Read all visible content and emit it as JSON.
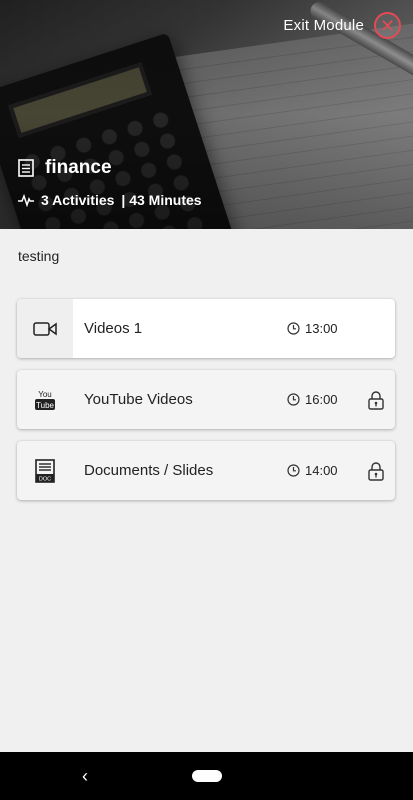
{
  "header": {
    "exit_label": "Exit Module",
    "exit_icon": "close-circle-icon",
    "module_title": "finance",
    "activities": "3 Activities",
    "separator_minutes": "| 43 Minutes",
    "accent_color": "#e44a55"
  },
  "description": "testing",
  "activities": [
    {
      "label": "Videos 1",
      "icon": "video-camera-icon",
      "duration": "13:00",
      "locked": false,
      "active": true
    },
    {
      "label": "YouTube Videos",
      "icon": "youtube-icon",
      "duration": "16:00",
      "locked": true,
      "active": false
    },
    {
      "label": "Documents / Slides",
      "icon": "document-icon",
      "duration": "14:00",
      "locked": true,
      "active": false
    }
  ],
  "youtube_icon_text": {
    "top": "You",
    "bottom": "Tube"
  },
  "document_icon_text": "DOC",
  "nav": {
    "back_glyph": "‹"
  }
}
